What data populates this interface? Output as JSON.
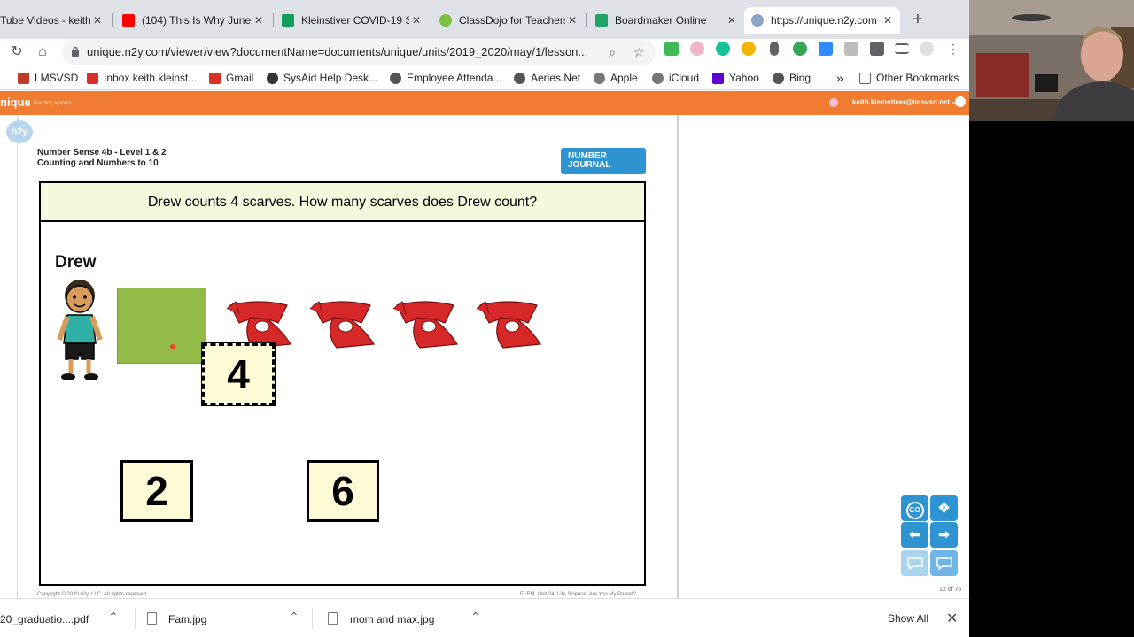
{
  "browser": {
    "tabs": [
      {
        "title": "Tube Videos - keith",
        "favicon_color": "#e0e0e0"
      },
      {
        "title": "(104) This Is Why June",
        "favicon_color": "#ff0000"
      },
      {
        "title": "Kleinstiver COVID-19 St",
        "favicon_color": "#0f9d58"
      },
      {
        "title": "ClassDojo for Teachers",
        "favicon_color": "#7ac142"
      },
      {
        "title": "Boardmaker Online",
        "favicon_color": "#21a366"
      },
      {
        "title": "https://unique.n2y.com",
        "favicon_color": "#8aa4c8"
      }
    ],
    "new_tab": "+",
    "url": "unique.n2y.com/viewer/view?documentName=documents/unique/units/2019_2020/may/1/lesson...",
    "bookmarks": [
      {
        "label": "LMSVSD",
        "color": "#c0392b"
      },
      {
        "label": "Inbox keith.kleinst...",
        "color": "#d93025"
      },
      {
        "label": "Gmail",
        "color": "#d93025"
      },
      {
        "label": "SysAid Help Desk...",
        "color": "#333333"
      },
      {
        "label": "Employee Attenda...",
        "color": "#555555"
      },
      {
        "label": "Aeries.Net",
        "color": "#555555"
      },
      {
        "label": "Apple",
        "color": "#777777"
      },
      {
        "label": "iCloud",
        "color": "#777777"
      },
      {
        "label": "Yahoo",
        "color": "#5f01d1"
      },
      {
        "label": "Bing",
        "color": "#555555"
      }
    ],
    "more_bookmarks": "»",
    "other_bookmarks": "Other Bookmarks"
  },
  "app": {
    "brand": "nique",
    "brand_sub": "learning system",
    "user_email": "keith.kleinstiver@lmsvsd.net",
    "accent": "#f07c31"
  },
  "lesson": {
    "logo": "n2y",
    "unit_line1": "Number Sense 4b - Level 1 & 2",
    "unit_line2": "Counting and Numbers to 10",
    "journal_line1": "NUMBER",
    "journal_line2": "JOURNAL",
    "question": "Drew counts 4 scarves.  How many scarves does Drew count?",
    "character": "Drew",
    "answers": {
      "placed": "4",
      "option_a": "2",
      "option_b": "6"
    },
    "copyright": "Copyright © 2020 n2y, LLC. All rights reserved.",
    "footer_ref": "ELEM. Unit 24, Life Science, Are You My Parent?",
    "page_count": "12 of 76"
  },
  "controls": {
    "go": "GO",
    "move": "✥",
    "prev": "⬅",
    "next": "➡",
    "blue": "#2e93d1",
    "blue_light": "#a9d3ef"
  },
  "downloads": {
    "items": [
      {
        "name": "20_graduatio....pdf"
      },
      {
        "name": "Fam.jpg"
      },
      {
        "name": "mom and max.jpg"
      }
    ],
    "show_all": "Show All",
    "close": "✕"
  }
}
